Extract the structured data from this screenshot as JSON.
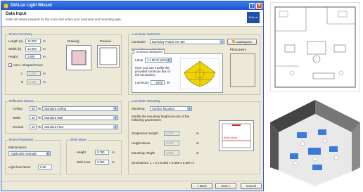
{
  "window": {
    "title": "DIALux Light Wizard"
  },
  "header": {
    "title": "Data Input",
    "subtitle": "Enter all values required for the room and select your luminaire and mounting type.",
    "logo": "DIALux"
  },
  "room_geometry": {
    "title": "Room Geometry",
    "length_label": "Length (a)",
    "length_value": "10.000",
    "length_unit": "m",
    "width_label": "Width (b)",
    "width_value": "10.000",
    "width_unit": "m",
    "height_label": "Height",
    "height_value": "2.800",
    "height_unit": "m",
    "lshape_label": "Use L-Shaped Room",
    "c_label": "c",
    "c_value": "2.500",
    "c_unit": "m",
    "d_label": "d",
    "d_value": "2.500",
    "d_unit": "m",
    "drawing_label": "Drawing",
    "preview_label": "Preview"
  },
  "luminaire": {
    "title": "Luminaire Selection",
    "luminaire_label": "Luminaire",
    "luminaire_value": "Bartholdy  Polaris  XX  400",
    "catalogues_button": "Catalogues",
    "hint": "Select the quantity from",
    "photometry_label": "Photometry",
    "tab_label": "Luminous distribution",
    "lamp_label": "Lamp",
    "lamp_value": "1 x 58 W (white)",
    "info_text": "Here you can modify the provided luminous flux of the luminaires.",
    "lumens_label": "Luminous",
    "lumens_value": "5400",
    "lumens_unit": "lm"
  },
  "reflection": {
    "title": "Reflection factors",
    "rows": [
      {
        "label": "Ceiling",
        "value": "80",
        "unit": "%",
        "material": "Standard Ceiling"
      },
      {
        "label": "Walls",
        "value": "50",
        "unit": "%",
        "material": "Standard Wall"
      },
      {
        "label": "Ground",
        "value": "20",
        "unit": "%",
        "material": "Standard Floor"
      }
    ]
  },
  "mounting": {
    "title": "Luminaire Mounting",
    "mounting_label": "Mounting",
    "mounting_value": "Surface Mounted",
    "info_text": "Modify the mounting height via one of the following parameters:",
    "suspension_label": "Suspension Height",
    "suspension_value": "0.000",
    "height_above_label": "Height above",
    "height_above_value": "2.800",
    "mounting_height_label": "Mounting Height",
    "mounting_height_value": "2.800",
    "unit": "m",
    "dimensions_text": "Dimensions: L = 0 x 0.308 x 0.308 x 0.397 m",
    "preview_label": "Work plane"
  },
  "room_params": {
    "title": "Room Parameter",
    "maintenance_label": "Maintenance",
    "maintenance_value": "Application example",
    "light_loss_label": "Light loss factor",
    "light_loss_value": "0.80"
  },
  "work_plane": {
    "title": "Work plane",
    "height_label": "Height",
    "height_value": "0.780",
    "height_unit": "m",
    "wall_zone_label": "Wall zone",
    "wall_zone_value": "0.000",
    "wall_zone_unit": "m"
  },
  "buttons": {
    "back": "< Back",
    "next": "Next >",
    "cancel": "Cancel"
  }
}
